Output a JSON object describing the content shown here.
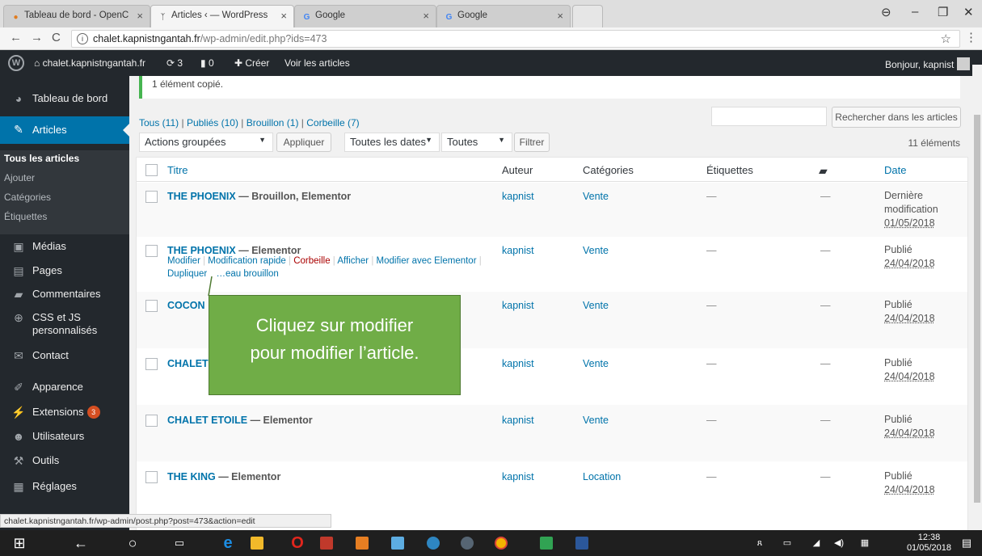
{
  "browser": {
    "tabs": [
      {
        "title": "Tableau de bord - OpenC",
        "favicon": "openclassrooms-icon"
      },
      {
        "title": "Articles ‹ — WordPress",
        "favicon": "wordpress-icon"
      },
      {
        "title": "Google",
        "favicon": "google-icon"
      },
      {
        "title": "Google",
        "favicon": "google-icon"
      }
    ],
    "url_host": "chalet.kapnistngantah.fr",
    "url_path": "/wp-admin/edit.php?ids=473",
    "status_url": "chalet.kapnistngantah.fr/wp-admin/post.php?post=473&action=edit"
  },
  "adminbar": {
    "site": "chalet.kapnistngantah.fr",
    "updates": "3",
    "comments": "0",
    "create": "Créer",
    "view": "Voir les articles",
    "greeting": "Bonjour, kapnist"
  },
  "sidebar": {
    "items": [
      {
        "label": "Tableau de bord",
        "icon": "dashboard-icon"
      },
      {
        "label": "Articles",
        "icon": "pin-icon"
      },
      {
        "label": "Médias",
        "icon": "media-icon"
      },
      {
        "label": "Pages",
        "icon": "page-icon"
      },
      {
        "label": "Commentaires",
        "icon": "comment-icon"
      },
      {
        "label": "CSS et JS personnalisés",
        "icon": "plus-circle-icon"
      },
      {
        "label": "Contact",
        "icon": "mail-icon"
      },
      {
        "label": "Apparence",
        "icon": "brush-icon"
      },
      {
        "label": "Extensions",
        "icon": "plugin-icon",
        "badge": "3"
      },
      {
        "label": "Utilisateurs",
        "icon": "users-icon"
      },
      {
        "label": "Outils",
        "icon": "wrench-icon"
      },
      {
        "label": "Réglages",
        "icon": "settings-icon"
      }
    ],
    "submenu": [
      "Tous les articles",
      "Ajouter",
      "Catégories",
      "Étiquettes"
    ]
  },
  "notice": "1 élément copié.",
  "filters": {
    "all": "Tous (11)",
    "published": "Publiés (10)",
    "draft": "Brouillon (1)",
    "trash": "Corbeille (7)",
    "bulk": "Actions groupées",
    "apply": "Appliquer",
    "dates": "Toutes les dates",
    "categories": "Toutes",
    "filter": "Filtrer",
    "search": "Rechercher dans les articles",
    "count": "11 éléments"
  },
  "table": {
    "headers": {
      "title": "Titre",
      "author": "Auteur",
      "categories": "Catégories",
      "tags": "Étiquettes",
      "date": "Date"
    },
    "rows": [
      {
        "title": "THE PHOENIX",
        "state": " — Brouillon, Elementor",
        "author": "kapnist",
        "category": "Vente",
        "tags": "—",
        "comments": "—",
        "date_status": "Dernière modification",
        "date": "01/05/2018"
      },
      {
        "title": "THE PHOENIX",
        "state": " — Elementor",
        "author": "kapnist",
        "category": "Vente",
        "tags": "—",
        "comments": "—",
        "date_status": "Publié",
        "date": "24/04/2018"
      },
      {
        "title": "COCON",
        "state": "",
        "author": "kapnist",
        "category": "Vente",
        "tags": "—",
        "comments": "—",
        "date_status": "Publié",
        "date": "24/04/2018"
      },
      {
        "title": "CHALET",
        "state": "",
        "author": "kapnist",
        "category": "Vente",
        "tags": "—",
        "comments": "—",
        "date_status": "Publié",
        "date": "24/04/2018"
      },
      {
        "title": "CHALET ETOILE",
        "state": " — Elementor",
        "author": "kapnist",
        "category": "Vente",
        "tags": "—",
        "comments": "—",
        "date_status": "Publié",
        "date": "24/04/2018"
      },
      {
        "title": "THE KING",
        "state": " — Elementor",
        "author": "kapnist",
        "category": "Location",
        "tags": "—",
        "comments": "—",
        "date_status": "Publié",
        "date": "24/04/2018"
      }
    ],
    "row_actions": {
      "edit": "Modifier",
      "quick_edit": "Modification rapide",
      "trash": "Corbeille",
      "view": "Afficher",
      "elementor": "Modifier avec Elementor",
      "duplicate": "Dupliquer",
      "new_draft": "…eau brouillon"
    }
  },
  "callout": {
    "line1": "Cliquez sur modifier",
    "line2": "pour modifier l’article."
  },
  "taskbar": {
    "time": "12:38",
    "date": "01/05/2018"
  },
  "colors": {
    "admin_dark": "#23282d",
    "wp_blue": "#0073aa",
    "callout_green": "#70ad47",
    "notice_green": "#46b450"
  }
}
